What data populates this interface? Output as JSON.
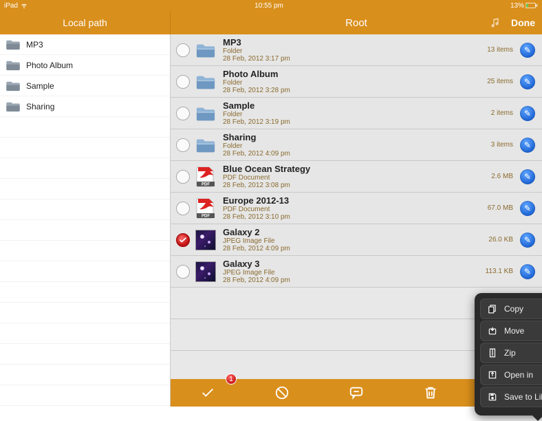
{
  "status": {
    "device": "iPad",
    "time": "10:55 pm",
    "battery": "13%"
  },
  "header": {
    "left_title": "Local path",
    "right_title": "Root",
    "done_label": "Done"
  },
  "sidebar": {
    "items": [
      {
        "label": "MP3"
      },
      {
        "label": "Photo Album"
      },
      {
        "label": "Sample"
      },
      {
        "label": "Sharing"
      }
    ]
  },
  "files": [
    {
      "name": "MP3",
      "kind": "Folder",
      "date": "28 Feb, 2012 3:17 pm",
      "size": "13 items",
      "type": "folder",
      "selected": false
    },
    {
      "name": "Photo Album",
      "kind": "Folder",
      "date": "28 Feb, 2012 3:28 pm",
      "size": "25 items",
      "type": "folder",
      "selected": false
    },
    {
      "name": "Sample",
      "kind": "Folder",
      "date": "28 Feb, 2012 3:19 pm",
      "size": "2 items",
      "type": "folder",
      "selected": false
    },
    {
      "name": "Sharing",
      "kind": "Folder",
      "date": "28 Feb, 2012 4:09 pm",
      "size": "3 items",
      "type": "folder",
      "selected": false
    },
    {
      "name": "Blue Ocean Strategy",
      "kind": "PDF Document",
      "date": "28 Feb, 2012 3:08 pm",
      "size": "2.6 MB",
      "type": "pdf",
      "selected": false
    },
    {
      "name": "Europe 2012-13",
      "kind": "PDF Document",
      "date": "28 Feb, 2012 3:10 pm",
      "size": "67.0 MB",
      "type": "pdf",
      "selected": false
    },
    {
      "name": "Galaxy 2",
      "kind": "JPEG Image File",
      "date": "28 Feb, 2012 4:09 pm",
      "size": "26.0 KB",
      "type": "image",
      "selected": true
    },
    {
      "name": "Galaxy 3",
      "kind": "JPEG Image File",
      "date": "28 Feb, 2012 4:09 pm",
      "size": "113.1 KB",
      "type": "image",
      "selected": false
    }
  ],
  "context_menu": {
    "items": [
      {
        "label": "Copy",
        "icon": "copy"
      },
      {
        "label": "Move",
        "icon": "move"
      },
      {
        "label": "Zip",
        "icon": "zip"
      },
      {
        "label": "Open in",
        "icon": "openin"
      },
      {
        "label": "Save to Library",
        "icon": "save"
      }
    ]
  },
  "toolbar": {
    "badge": "1"
  },
  "info_icon_glyph": "✎"
}
